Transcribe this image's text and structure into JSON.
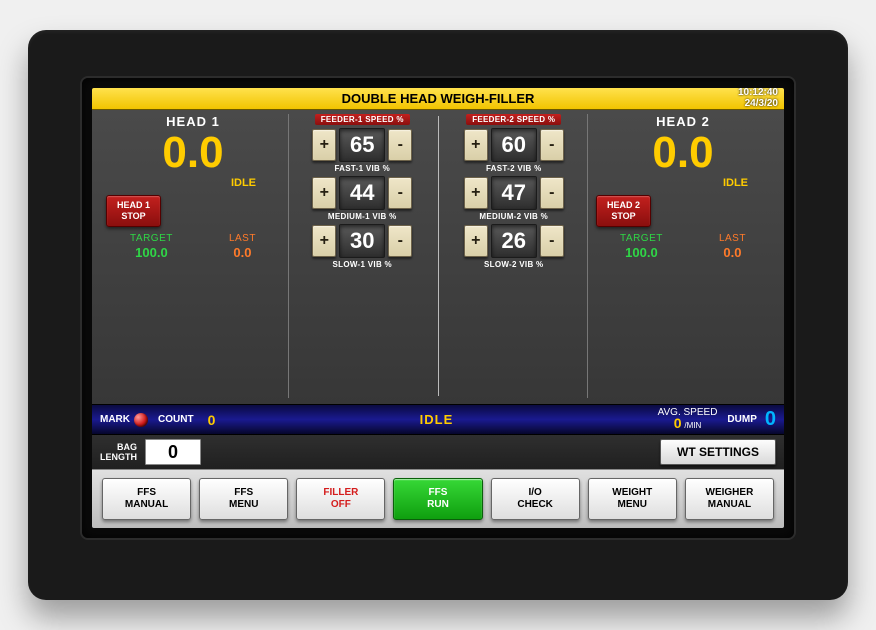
{
  "title": "DOUBLE HEAD WEIGH-FILLER",
  "time": "10:12:40",
  "date": "24/3/20",
  "heads": {
    "left": {
      "title": "HEAD 1",
      "value": "0.0",
      "status": "IDLE",
      "stop_l1": "HEAD 1",
      "stop_l2": "STOP",
      "target_lbl": "TARGET",
      "target_val": "100.0",
      "last_lbl": "LAST",
      "last_val": "0.0"
    },
    "right": {
      "title": "HEAD 2",
      "value": "0.0",
      "status": "IDLE",
      "stop_l1": "HEAD 2",
      "stop_l2": "STOP",
      "target_lbl": "TARGET",
      "target_val": "100.0",
      "last_lbl": "LAST",
      "last_val": "0.0"
    }
  },
  "feeders": {
    "f1": {
      "hdr": "FEEDER-1 SPEED %",
      "fast": "65",
      "fast_lbl": "FAST-1 VIB %",
      "med": "44",
      "med_lbl": "MEDIUM-1 VIB %",
      "slow": "30",
      "slow_lbl": "SLOW-1 VIB %"
    },
    "f2": {
      "hdr": "FEEDER-2 SPEED %",
      "fast": "60",
      "fast_lbl": "FAST-2 VIB %",
      "med": "47",
      "med_lbl": "MEDIUM-2 VIB %",
      "slow": "26",
      "slow_lbl": "SLOW-2 VIB %"
    },
    "plus": "+",
    "minus": "-"
  },
  "strip": {
    "mark": "MARK",
    "count_lbl": "COUNT",
    "count_val": "0",
    "status": "IDLE",
    "avg_lbl": "AVG. SPEED",
    "avg_val": "0",
    "avg_unit": "/MIN",
    "dump_lbl": "DUMP",
    "dump_val": "0"
  },
  "bag": {
    "lbl_l1": "BAG",
    "lbl_l2": "LENGTH",
    "val": "0",
    "wt_btn": "WT SETTINGS"
  },
  "buttons": {
    "b1": "FFS\nMANUAL",
    "b2": "FFS\nMENU",
    "b3": "FILLER\nOFF",
    "b4": "FFS\nRUN",
    "b5": "I/O\nCHECK",
    "b6": "WEIGHT\nMENU",
    "b7": "WEIGHER\nMANUAL"
  }
}
